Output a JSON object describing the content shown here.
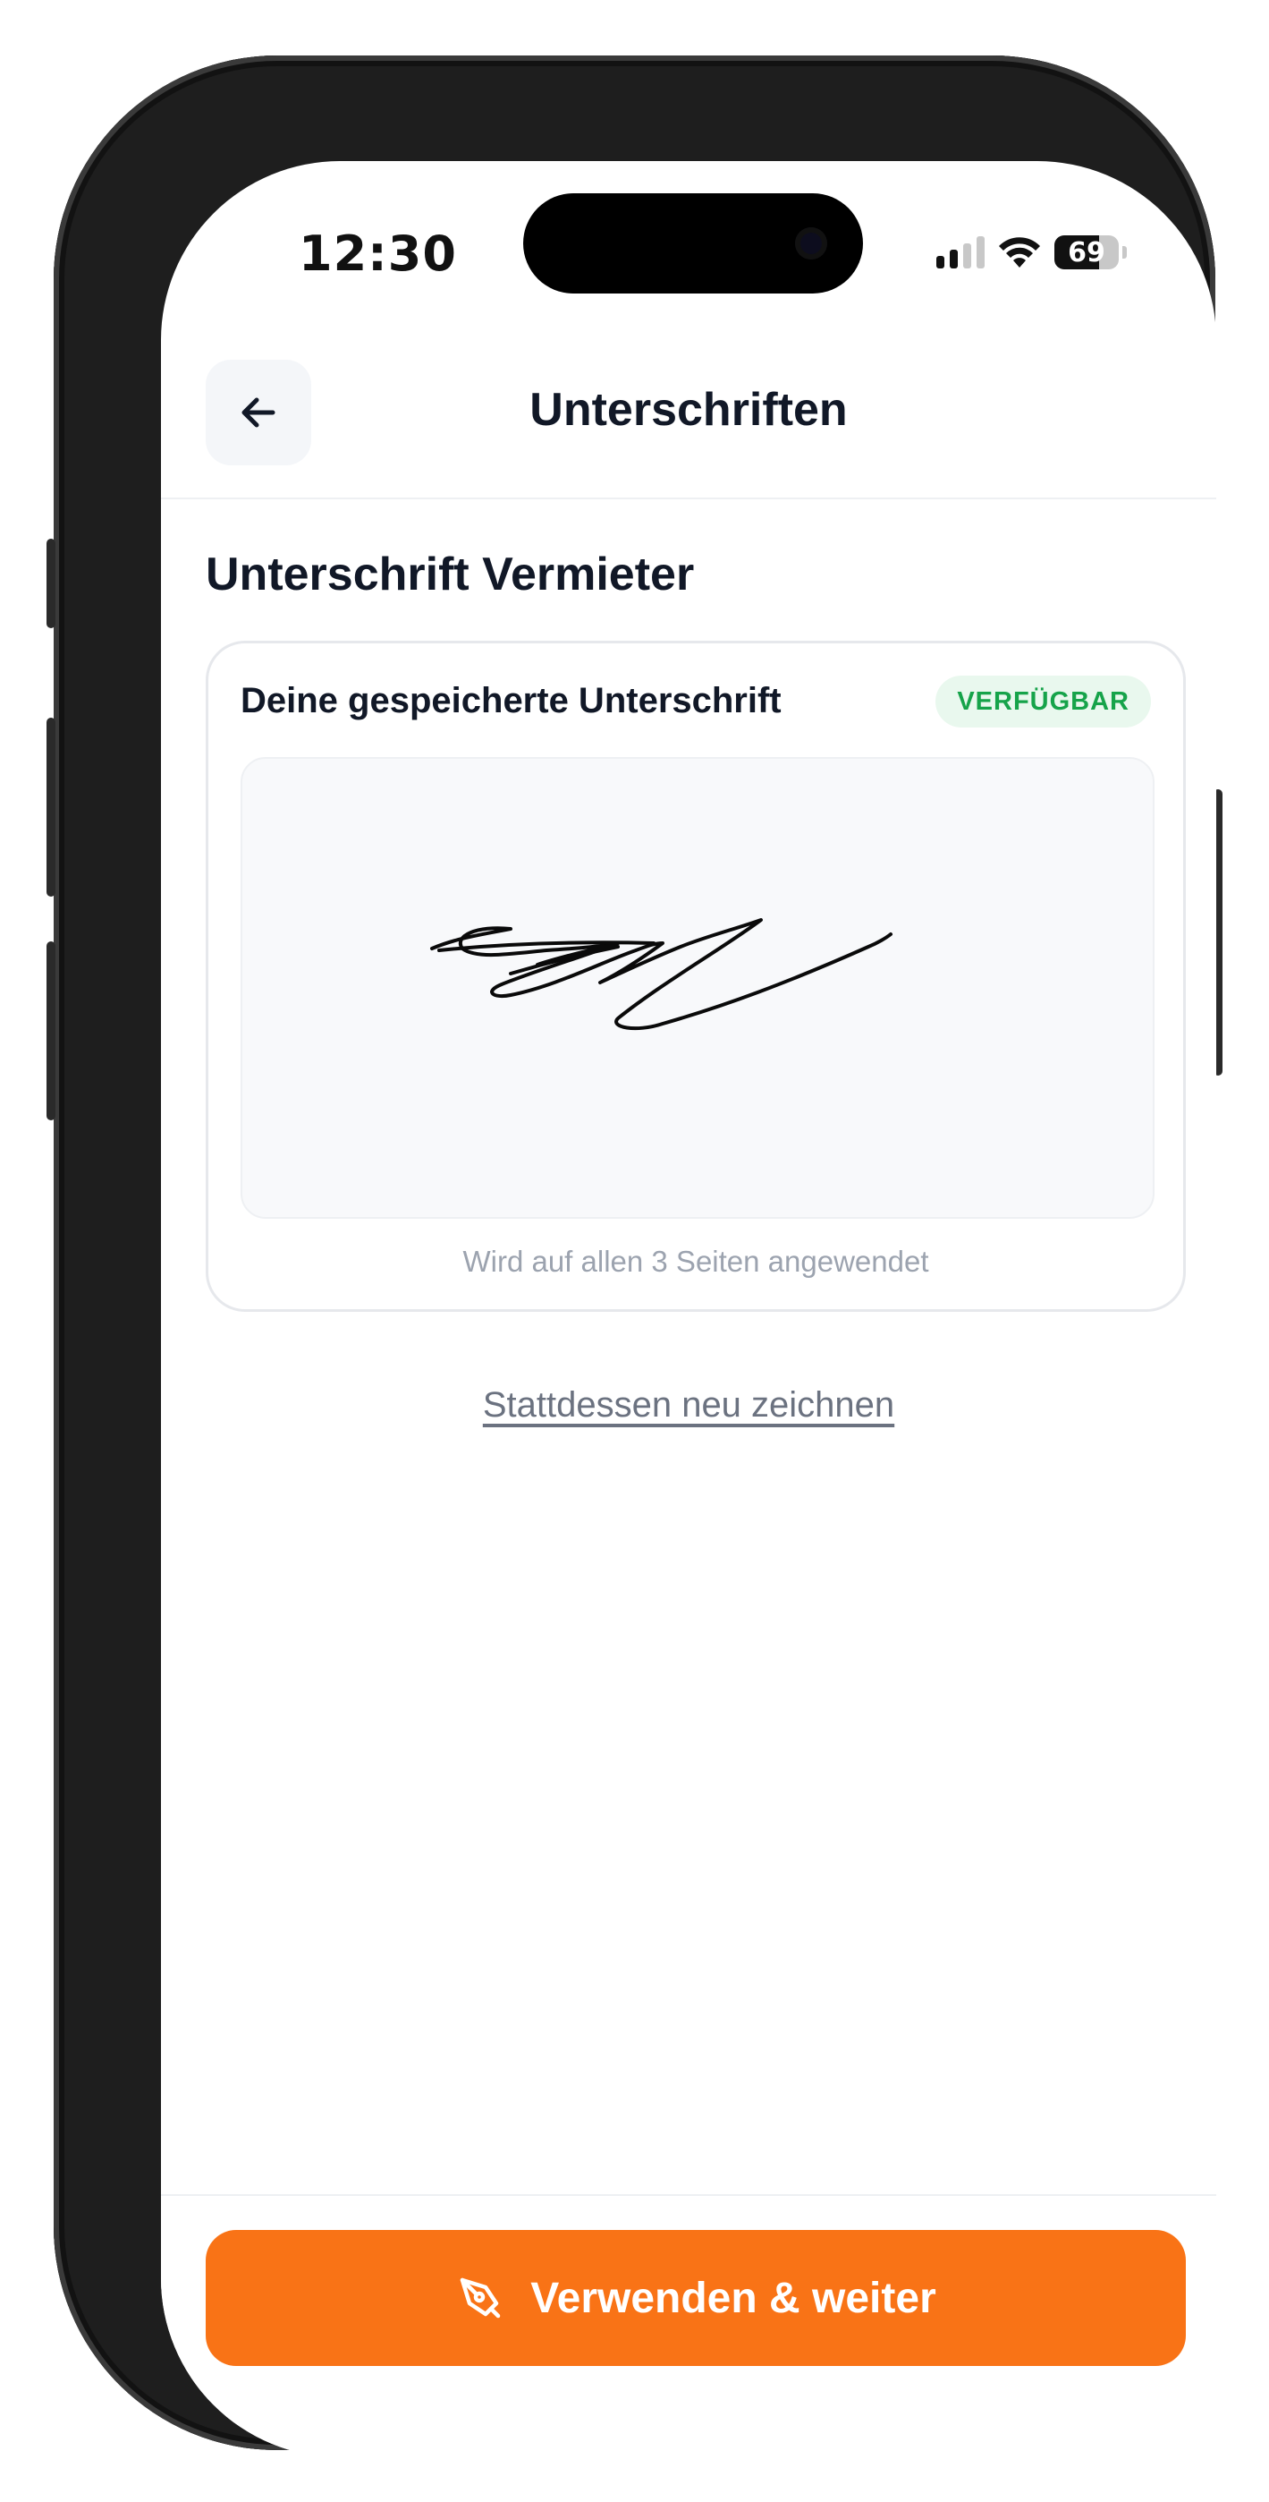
{
  "status_bar": {
    "time": "12:30",
    "battery_level": "69",
    "signal_bars_active": 2,
    "signal_bars_total": 4
  },
  "header": {
    "title": "Unterschriften",
    "back_icon": "arrow-left-icon"
  },
  "section": {
    "title": "Unterschrift Vermieter"
  },
  "signature_card": {
    "title": "Deine gespeicherte Unterschrift",
    "badge": "VERFÜGBAR",
    "note": "Wird auf allen 3 Seiten angewendet"
  },
  "redraw_link": {
    "label": "Stattdessen neu zeichnen"
  },
  "primary_button": {
    "label": "Verwenden & weiter",
    "icon": "pen-tool-icon"
  },
  "colors": {
    "accent": "#f97316",
    "badge_text": "#16a34a",
    "badge_bg": "#e9f8ee",
    "title_text": "#111827"
  }
}
